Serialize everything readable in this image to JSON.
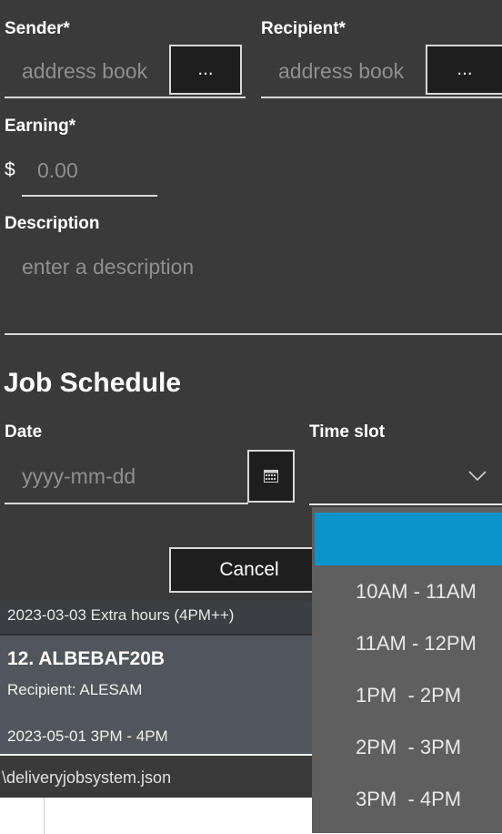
{
  "form": {
    "sender_label": "Sender*",
    "sender_placeholder": "address book",
    "sender_button": "...",
    "recipient_label": "Recipient*",
    "recipient_placeholder": "address book",
    "recipient_button": "...",
    "earning_label": "Earning*",
    "currency": "$",
    "earning_placeholder": "0.00",
    "description_label": "Description",
    "description_placeholder": "enter a description"
  },
  "schedule": {
    "heading": "Job Schedule",
    "date_label": "Date",
    "date_placeholder": "yyyy-mm-dd",
    "timeslot_label": "Time slot",
    "timeslot_value": ""
  },
  "actions": {
    "cancel": "Cancel"
  },
  "timeslot_options": [
    "",
    "10AM - 11AM",
    "11AM - 12PM",
    "1PM  - 2PM",
    "2PM  - 3PM",
    "3PM  - 4PM"
  ],
  "background_list": {
    "row1": "2023-03-03 Extra hours (4PM++)",
    "card_title": "12.  ALBEBAF20B",
    "card_recipient": "Recipient: ALESAM",
    "card_time": "2023-05-01 3PM  - 4PM",
    "status": "\\deliveryjobsystem.json"
  },
  "colors": {
    "dialog_bg": "#3a3a3a",
    "popup_bg": "#5f5f5f",
    "selected": "#0a94c9"
  }
}
